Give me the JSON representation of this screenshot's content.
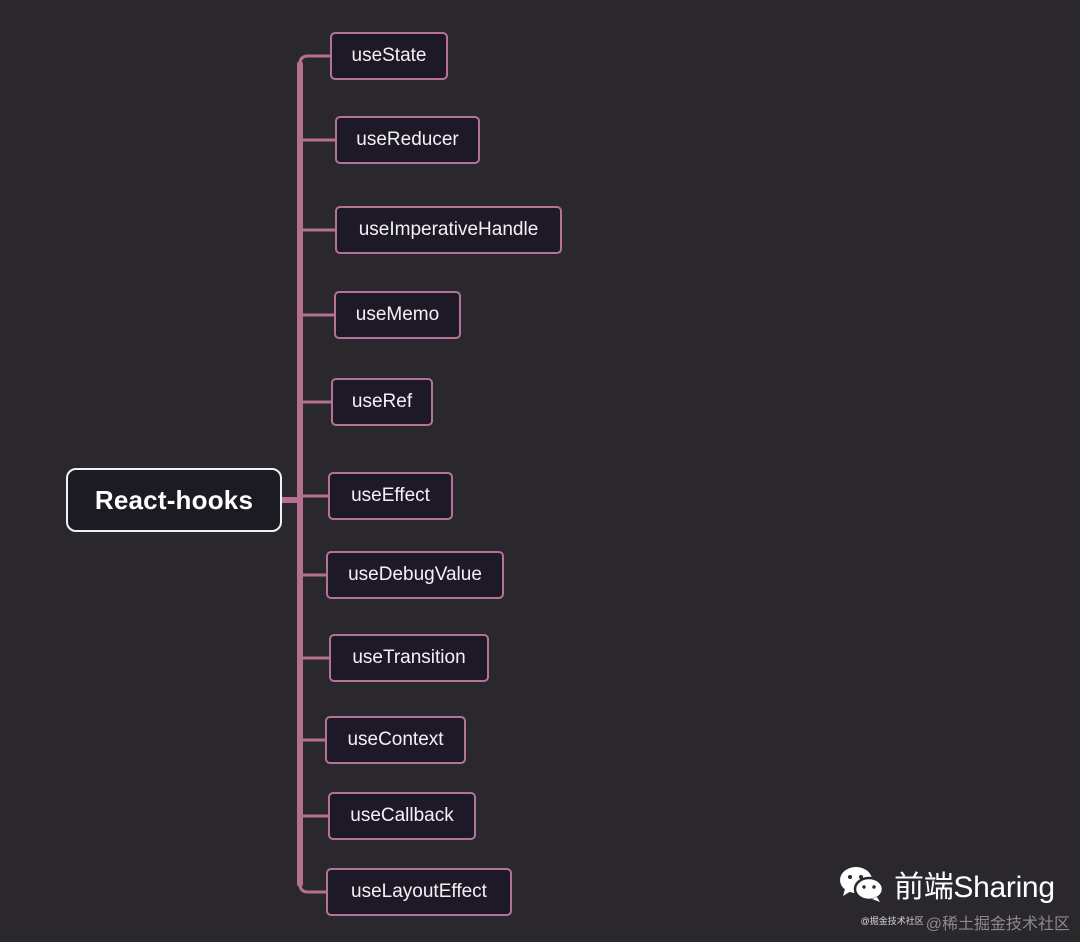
{
  "root": {
    "label": "React-hooks"
  },
  "hooks": [
    {
      "label": "useState"
    },
    {
      "label": "useReducer"
    },
    {
      "label": "useImperativeHandle"
    },
    {
      "label": "useMemo"
    },
    {
      "label": "useRef"
    },
    {
      "label": "useEffect"
    },
    {
      "label": "useDebugValue"
    },
    {
      "label": "useTransition"
    },
    {
      "label": "useContext"
    },
    {
      "label": "useCallback"
    },
    {
      "label": "useLayoutEffect"
    }
  ],
  "watermark": {
    "brand": "前端Sharing",
    "tiny": "@掘金技术社区",
    "sub": "@稀土掘金技术社区"
  },
  "colors": {
    "background": "#2a282d",
    "connector": "#b6708f",
    "node_border": "#b37399",
    "root_border": "#f2f0f4"
  }
}
